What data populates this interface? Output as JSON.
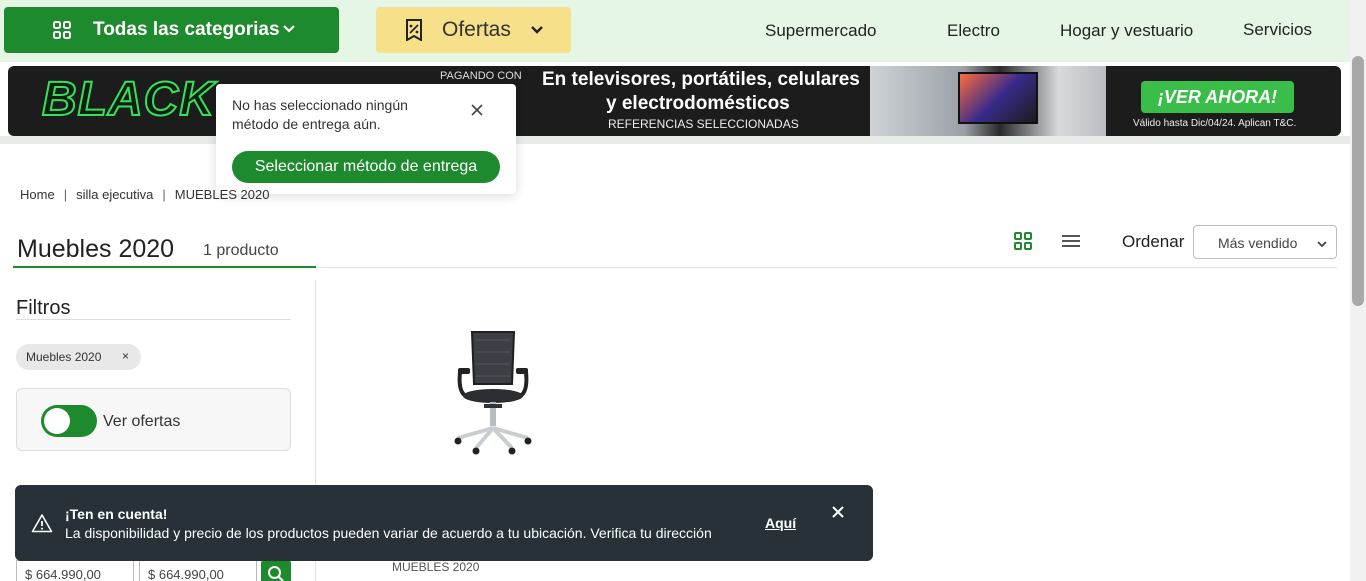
{
  "topnav": {
    "categories_label": "Todas las categorias",
    "offers_label": "Ofertas",
    "links": [
      "Supermercado",
      "Electro",
      "Hogar y vestuario",
      "Servicios"
    ],
    "colors": {
      "primary": "#1d8a2e",
      "offers_bg": "#f6e08a",
      "nav_bg": "#e6f6e4"
    }
  },
  "banner": {
    "black_text": "BLACK",
    "pagando": "PAGANDO CON",
    "headline1": "En televisores, portátiles, celulares",
    "headline2": "y electrodomésticos",
    "refs": "REFERENCIAS SELECCIONADAS",
    "cta": "¡VER AHORA!",
    "valid": "Válido hasta Dic/04/24. Aplican T&C."
  },
  "popover": {
    "message": "No has seleccionado ningún método de entrega aún.",
    "button": "Seleccionar método de entrega"
  },
  "breadcrumb": [
    "Home",
    "silla ejecutiva",
    "MUEBLES 2020"
  ],
  "header": {
    "title": "Muebles 2020",
    "count": "1 producto",
    "sort_label": "Ordenar",
    "sort_value": "Más vendido"
  },
  "filters": {
    "title": "Filtros",
    "chip": "Muebles 2020",
    "chip_remove": "×",
    "offers_label": "Ver ofertas",
    "offers_on": true,
    "price_min": "$ 664.990,00",
    "price_max": "$ 664.990,00"
  },
  "product": {
    "brand": "MUEBLES 2020"
  },
  "toast": {
    "title": "¡Ten en cuenta!",
    "message": "La disponibilidad y precio de los productos pueden variar de acuerdo a tu ubicación. Verifica tu dirección",
    "link": "Aquí"
  }
}
